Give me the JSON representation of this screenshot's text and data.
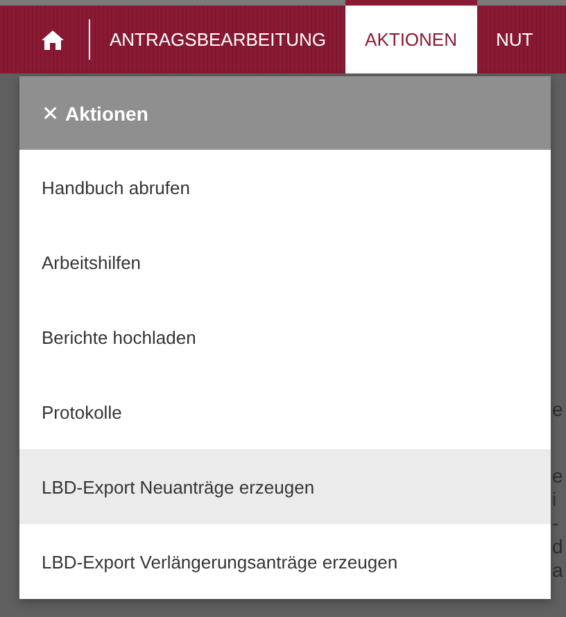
{
  "nav": {
    "tabs": [
      {
        "kind": "home",
        "selected": false
      },
      {
        "kind": "text",
        "label": "ANTRAGSBEARBEITUNG",
        "selected": false
      },
      {
        "kind": "text",
        "label": "AKTIONEN",
        "selected": true
      },
      {
        "kind": "text",
        "label": "NUT",
        "selected": false
      }
    ]
  },
  "menu": {
    "close": "✕",
    "title": "Aktionen",
    "items": [
      {
        "label": "Handbuch abrufen",
        "selected": false
      },
      {
        "label": "Arbeitshilfen",
        "selected": false
      },
      {
        "label": "Berichte hochladen",
        "selected": false
      },
      {
        "label": "Protokolle",
        "selected": false
      },
      {
        "label": "LBD-Export Neuanträge erzeugen",
        "selected": true
      },
      {
        "label": "LBD-Export Verlängerungsanträge erzeugen",
        "selected": false
      }
    ]
  },
  "background_text": [
    "e",
    "e",
    "i",
    "-",
    "d",
    "a"
  ]
}
